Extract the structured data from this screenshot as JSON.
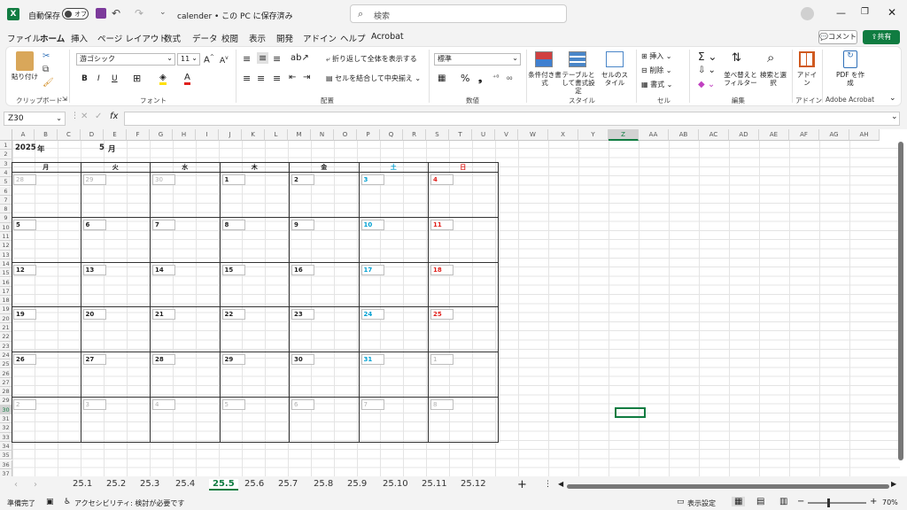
{
  "app": {
    "autosave_label": "自動保存",
    "autosave_state": "オフ",
    "filename": "calender • この PC に保存済み",
    "search_placeholder": "検索"
  },
  "tabs": [
    "ファイル",
    "ホーム",
    "挿入",
    "ページ レイアウト",
    "数式",
    "データ",
    "校閲",
    "表示",
    "開発",
    "アドイン",
    "ヘルプ",
    "Acrobat"
  ],
  "active_tab": "ホーム",
  "top_right": {
    "comment": "コメント",
    "share": "共有"
  },
  "ribbon": {
    "clipboard": {
      "paste": "貼り付け",
      "group": "クリップボード"
    },
    "font": {
      "name": "游ゴシック",
      "size": "11",
      "group": "フォント"
    },
    "alignment": {
      "wrap": "折り返して全体を表示する",
      "merge": "セルを結合して中央揃え",
      "group": "配置"
    },
    "number": {
      "format": "標準",
      "group": "数値"
    },
    "styles": {
      "conditional": "条件付き書式",
      "table": "テーブルとして書式設定",
      "cell": "セルのスタイル",
      "group": "スタイル"
    },
    "cells": {
      "insert": "挿入",
      "delete": "削除",
      "format": "書式",
      "group": "セル"
    },
    "editing": {
      "sort": "並べ替えとフィルター",
      "find": "検索と選択",
      "group": "編集"
    },
    "addins": {
      "label": "アドイン",
      "group": "アドイン"
    },
    "acrobat": {
      "label": "PDF を作成",
      "group": "Adobe Acrobat"
    }
  },
  "namebox": "Z30",
  "columns": [
    "A",
    "B",
    "C",
    "D",
    "E",
    "F",
    "G",
    "H",
    "I",
    "J",
    "K",
    "L",
    "M",
    "N",
    "O",
    "P",
    "Q",
    "R",
    "S",
    "T",
    "U",
    "V",
    "W",
    "X",
    "Y",
    "Z",
    "AA",
    "AB",
    "AC",
    "AD",
    "AE",
    "AF",
    "AG",
    "AH"
  ],
  "calendar": {
    "year": "2025",
    "year_unit": "年",
    "month": "5",
    "month_unit": "月",
    "weekdays": [
      "月",
      "火",
      "水",
      "木",
      "金",
      "土",
      "日"
    ],
    "weeks": [
      [
        "28",
        "29",
        "30",
        "1",
        "2",
        "3",
        "4"
      ],
      [
        "5",
        "6",
        "7",
        "8",
        "9",
        "10",
        "11"
      ],
      [
        "12",
        "13",
        "14",
        "15",
        "16",
        "17",
        "18"
      ],
      [
        "19",
        "20",
        "21",
        "22",
        "23",
        "24",
        "25"
      ],
      [
        "26",
        "27",
        "28",
        "29",
        "30",
        "31",
        "1"
      ],
      [
        "2",
        "3",
        "4",
        "5",
        "6",
        "7",
        "8"
      ]
    ],
    "current_month_mask": [
      [
        false,
        false,
        false,
        true,
        true,
        true,
        true
      ],
      [
        true,
        true,
        true,
        true,
        true,
        true,
        true
      ],
      [
        true,
        true,
        true,
        true,
        true,
        true,
        true
      ],
      [
        true,
        true,
        true,
        true,
        true,
        true,
        true
      ],
      [
        true,
        true,
        true,
        true,
        true,
        true,
        false
      ],
      [
        false,
        false,
        false,
        false,
        false,
        false,
        false
      ]
    ]
  },
  "sheets": [
    "25.1",
    "25.2",
    "25.3",
    "25.4",
    "25.5",
    "25.6",
    "25.7",
    "25.8",
    "25.9",
    "25.10",
    "25.11",
    "25.12"
  ],
  "active_sheet": "25.5",
  "status": {
    "ready": "準備完了",
    "accessibility": "アクセシビリティ: 検討が必要です",
    "display_settings": "表示設定",
    "zoom": "70%"
  },
  "colors": {
    "accent": "#107c41",
    "saturday": "#00a0d2",
    "sunday": "#e0201c",
    "other_month": "#b0b0b0"
  }
}
